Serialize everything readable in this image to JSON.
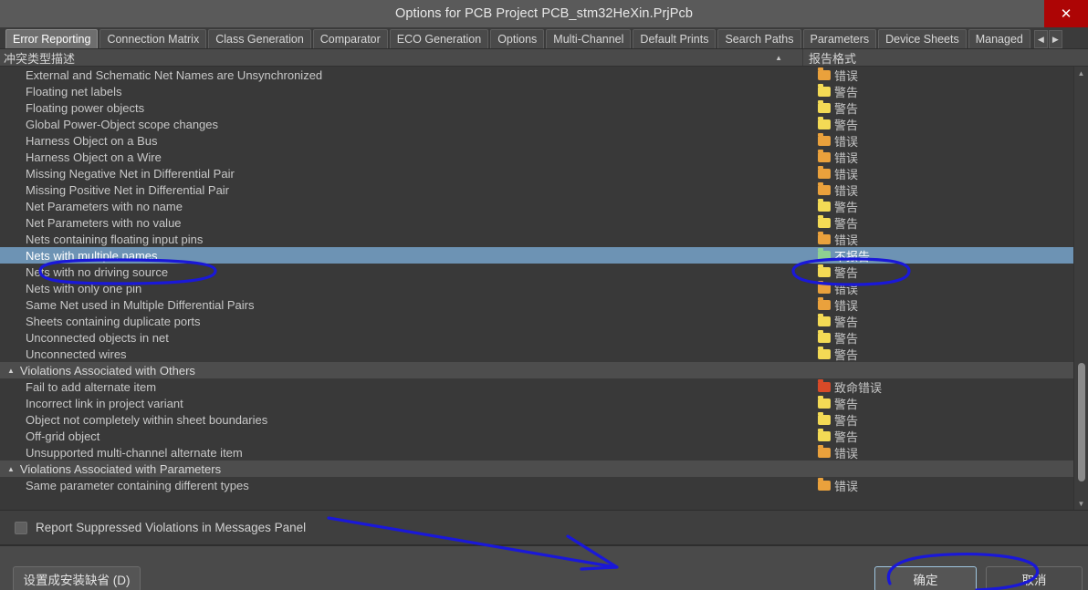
{
  "window": {
    "title": "Options for PCB Project PCB_stm32HeXin.PrjPcb",
    "close_label": "✕",
    "close_icon": "close-icon"
  },
  "tabs": {
    "items": [
      {
        "label": "Error Reporting",
        "active": true
      },
      {
        "label": "Connection Matrix",
        "active": false
      },
      {
        "label": "Class Generation",
        "active": false
      },
      {
        "label": "Comparator",
        "active": false
      },
      {
        "label": "ECO Generation",
        "active": false
      },
      {
        "label": "Options",
        "active": false
      },
      {
        "label": "Multi-Channel",
        "active": false
      },
      {
        "label": "Default Prints",
        "active": false
      },
      {
        "label": "Search Paths",
        "active": false
      },
      {
        "label": "Parameters",
        "active": false
      },
      {
        "label": "Device Sheets",
        "active": false
      },
      {
        "label": "Managed",
        "active": false
      }
    ],
    "scroll_left_label": "◀",
    "scroll_right_label": "▶"
  },
  "grid": {
    "columns": [
      {
        "label": "冲突类型描述",
        "sort_indicator": "▲"
      },
      {
        "label": "报告格式"
      }
    ],
    "rows": [
      {
        "name": "External and Schematic Net Names are Unsynchronized",
        "value": "错误",
        "severity": "error",
        "type": "item",
        "selected": false
      },
      {
        "name": "Floating net labels",
        "value": "警告",
        "severity": "warning",
        "type": "item",
        "selected": false
      },
      {
        "name": "Floating power objects",
        "value": "警告",
        "severity": "warning",
        "type": "item",
        "selected": false
      },
      {
        "name": "Global Power-Object scope changes",
        "value": "警告",
        "severity": "warning",
        "type": "item",
        "selected": false
      },
      {
        "name": "Harness Object on a Bus",
        "value": "错误",
        "severity": "error",
        "type": "item",
        "selected": false
      },
      {
        "name": "Harness Object on a Wire",
        "value": "错误",
        "severity": "error",
        "type": "item",
        "selected": false
      },
      {
        "name": "Missing Negative Net in Differential Pair",
        "value": "错误",
        "severity": "error",
        "type": "item",
        "selected": false
      },
      {
        "name": "Missing Positive Net in Differential Pair",
        "value": "错误",
        "severity": "error",
        "type": "item",
        "selected": false
      },
      {
        "name": "Net Parameters with no name",
        "value": "警告",
        "severity": "warning",
        "type": "item",
        "selected": false
      },
      {
        "name": "Net Parameters with no value",
        "value": "警告",
        "severity": "warning",
        "type": "item",
        "selected": false
      },
      {
        "name": "Nets containing floating input pins",
        "value": "错误",
        "severity": "error",
        "type": "item",
        "selected": false
      },
      {
        "name": "Nets with multiple names",
        "value": "不报告",
        "severity": "none",
        "type": "item",
        "selected": true
      },
      {
        "name": "Nets with no driving source",
        "value": "警告",
        "severity": "warning",
        "type": "item",
        "selected": false
      },
      {
        "name": "Nets with only one pin",
        "value": "错误",
        "severity": "error",
        "type": "item",
        "selected": false
      },
      {
        "name": "Same Net used in Multiple Differential Pairs",
        "value": "错误",
        "severity": "error",
        "type": "item",
        "selected": false
      },
      {
        "name": "Sheets containing duplicate ports",
        "value": "警告",
        "severity": "warning",
        "type": "item",
        "selected": false
      },
      {
        "name": "Unconnected objects in net",
        "value": "警告",
        "severity": "warning",
        "type": "item",
        "selected": false
      },
      {
        "name": "Unconnected wires",
        "value": "警告",
        "severity": "warning",
        "type": "item",
        "selected": false
      },
      {
        "name": "Violations Associated with Others",
        "value": "",
        "severity": "",
        "type": "group",
        "selected": false
      },
      {
        "name": "Fail to add alternate item",
        "value": "致命错误",
        "severity": "fatal",
        "type": "item",
        "selected": false
      },
      {
        "name": "Incorrect link in project variant",
        "value": "警告",
        "severity": "warning",
        "type": "item",
        "selected": false
      },
      {
        "name": "Object not completely within sheet boundaries",
        "value": "警告",
        "severity": "warning",
        "type": "item",
        "selected": false
      },
      {
        "name": "Off-grid object",
        "value": "警告",
        "severity": "warning",
        "type": "item",
        "selected": false
      },
      {
        "name": "Unsupported multi-channel alternate item",
        "value": "错误",
        "severity": "error",
        "type": "item",
        "selected": false
      },
      {
        "name": "Violations Associated with Parameters",
        "value": "",
        "severity": "",
        "type": "group",
        "selected": false
      },
      {
        "name": "Same parameter containing different types",
        "value": "错误",
        "severity": "error",
        "type": "item",
        "selected": false
      }
    ],
    "group_collapse_icon": "▲",
    "severity_colors": {
      "fatal": "#d84a28",
      "error": "#eaa13c",
      "warning": "#f3da55",
      "none": "#8fcf92"
    },
    "scrollbar": {
      "up_label": "▲",
      "down_label": "▼"
    }
  },
  "options": {
    "report_suppressed_label": "Report Suppressed Violations in Messages Panel",
    "report_suppressed_checked": false
  },
  "footer": {
    "set_default_label": "设置成安装缺省 (D)",
    "ok_label": "确定",
    "cancel_label": "取消"
  },
  "annotations": {
    "accent_color": "#1a18d8",
    "marks": [
      "ellipse-around-selected-row-name",
      "ellipse-around-selected-row-value",
      "arrow-pointing-to-ok-button",
      "ellipse-around-ok-button"
    ]
  }
}
